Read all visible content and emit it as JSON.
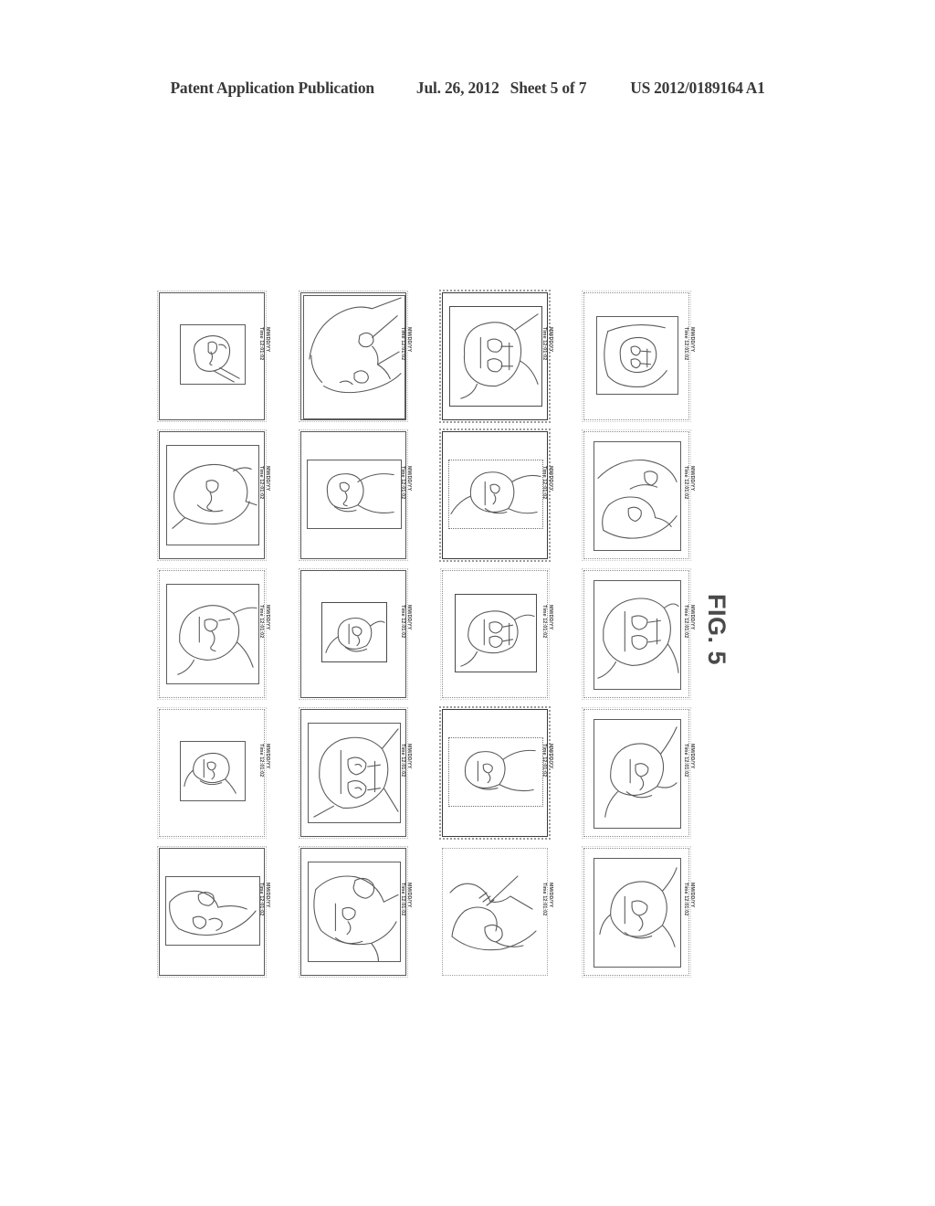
{
  "header": {
    "publication": "Patent Application Publication",
    "date": "Jul. 26, 2012",
    "sheet": "Sheet 5 of 7",
    "number": "US 2012/0189164 A1"
  },
  "figure": {
    "label": "FIG. 5",
    "rows": 5,
    "columns": 4,
    "stamp_date": "MM/DD/YY",
    "stamp_time": "Time 12:01:02",
    "cells": [
      {
        "id": "r1c1",
        "stamp_date": "MM/DD/YY",
        "stamp_time": "Time 12:01:02"
      },
      {
        "id": "r1c2",
        "stamp_date": "MM/DD/YY",
        "stamp_time": "Time 12:01:02"
      },
      {
        "id": "r1c3",
        "stamp_date": "MM/DD/YY",
        "stamp_time": "Time 12:01:02"
      },
      {
        "id": "r1c4",
        "stamp_date": "MM/DD/YY",
        "stamp_time": "Time 12:01:02"
      },
      {
        "id": "r2c1",
        "stamp_date": "MM/DD/YY",
        "stamp_time": "Time 12:01:02"
      },
      {
        "id": "r2c2",
        "stamp_date": "MM/DD/YY",
        "stamp_time": "Time 12:01:02"
      },
      {
        "id": "r2c3",
        "stamp_date": "MM/DD/YY",
        "stamp_time": "Time 12:01:02"
      },
      {
        "id": "r2c4",
        "stamp_date": "MM/DD/YY",
        "stamp_time": "Time 12:01:02"
      },
      {
        "id": "r3c1",
        "stamp_date": "MM/DD/YY",
        "stamp_time": "Time 12:01:02"
      },
      {
        "id": "r3c2",
        "stamp_date": "MM/DD/YY",
        "stamp_time": "Time 12:01:02"
      },
      {
        "id": "r3c3",
        "stamp_date": "MM/DD/YY",
        "stamp_time": "Time 12:01:02"
      },
      {
        "id": "r3c4",
        "stamp_date": "MM/DD/YY",
        "stamp_time": "Time 12:01:02"
      },
      {
        "id": "r4c1",
        "stamp_date": "MM/DD/YY",
        "stamp_time": "Time 12:01:02"
      },
      {
        "id": "r4c2",
        "stamp_date": "MM/DD/YY",
        "stamp_time": "Time 12:01:02"
      },
      {
        "id": "r4c3",
        "stamp_date": "MM/DD/YY",
        "stamp_time": "Time 12:01:02"
      },
      {
        "id": "r4c4",
        "stamp_date": "MM/DD/YY",
        "stamp_time": "Time 12:01:02"
      },
      {
        "id": "r5c1",
        "stamp_date": "MM/DD/YY",
        "stamp_time": "Time 12:01:02"
      },
      {
        "id": "r5c2",
        "stamp_date": "MM/DD/YY",
        "stamp_time": "Time 12:01:02"
      },
      {
        "id": "r5c3",
        "stamp_date": "MM/DD/YY",
        "stamp_time": "Time 12:01:02"
      },
      {
        "id": "r5c4",
        "stamp_date": "MM/DD/YY",
        "stamp_time": "Time 12:01:02"
      }
    ]
  }
}
